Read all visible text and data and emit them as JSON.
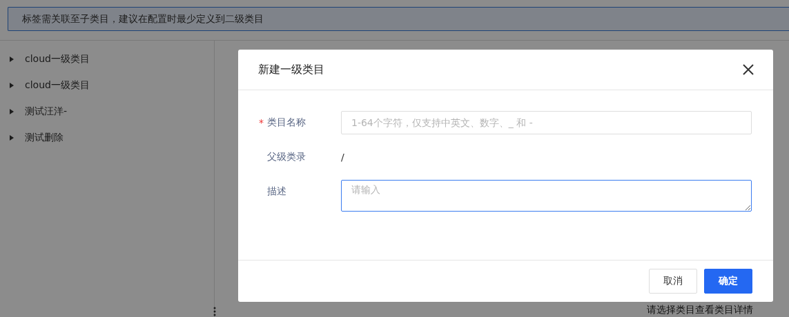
{
  "alert": {
    "text": "标签需关联至子类目，建议在配置时最少定义到二级类目"
  },
  "tree": {
    "items": [
      {
        "label": "cloud一级类目",
        "expanded": false
      },
      {
        "label": "cloud一级类目",
        "expanded": false
      },
      {
        "label": "测试汪洋-",
        "expanded": false
      },
      {
        "label": "测试删除",
        "expanded": false
      }
    ]
  },
  "detail": {
    "empty_text": "请选择类目查看类目详情"
  },
  "dialog": {
    "title": "新建一级类目",
    "fields": [
      {
        "kind": "input",
        "label": "类目名称",
        "required_mark": "*",
        "placeholder": "1-64个字符，仅支持中英文、数字、_ 和 -"
      },
      {
        "kind": "text",
        "label": "父级类录",
        "value": "/"
      },
      {
        "kind": "textarea",
        "label": "描述",
        "placeholder": "请输入",
        "focused": true
      }
    ],
    "buttons": [
      {
        "label": "取消",
        "kind": "default"
      },
      {
        "label": "确定",
        "kind": "primary"
      }
    ]
  }
}
